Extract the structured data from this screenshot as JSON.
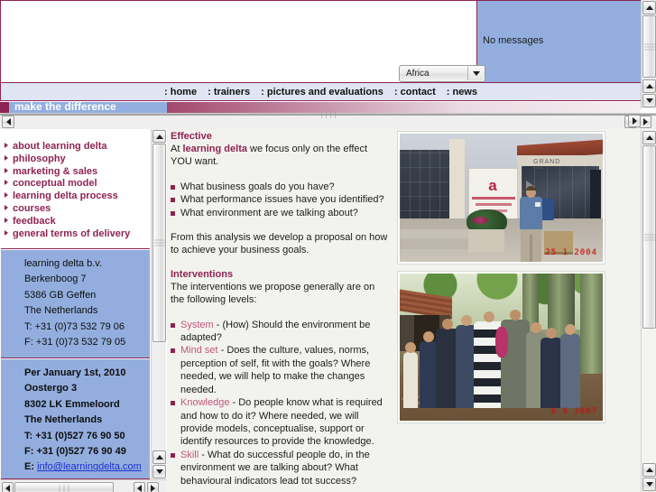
{
  "window": {
    "messages_panel": {
      "text": "No messages"
    },
    "country_select": {
      "value": "Africa",
      "arrow_icon": "chevron-down-icon"
    },
    "banner_tagline": "make the difference"
  },
  "navbar": {
    "items": [
      {
        "label": "home"
      },
      {
        "label": "trainers"
      },
      {
        "label": "pictures and evaluations"
      },
      {
        "label": "contact"
      },
      {
        "label": "news"
      }
    ]
  },
  "sidebar": {
    "nav_items": [
      {
        "label": "about learning delta"
      },
      {
        "label": "philosophy"
      },
      {
        "label": "marketing & sales"
      },
      {
        "label": "conceptual model"
      },
      {
        "label": "learning delta process"
      },
      {
        "label": "courses"
      },
      {
        "label": "feedback"
      },
      {
        "label": "general terms of delivery"
      }
    ],
    "address_current": {
      "lines": [
        "learning delta b.v.",
        "Berkenboog 7",
        "5386 GB Geffen",
        "The Netherlands",
        "T: +31 (0)73 532 79 06",
        "F: +31 (0)73 532 79 05"
      ]
    },
    "address_new": {
      "lines": [
        "Per January 1st, 2010",
        "Oostergo 3",
        "8302 LK Emmeloord",
        "The Netherlands",
        "T: +31 (0)527 76 90 50",
        "F: +31 (0)527 76 90 49"
      ],
      "email_label": "E:",
      "email": "info@learningdelta.com"
    }
  },
  "article": {
    "section1": {
      "heading": "Effective",
      "intro_before": "At ",
      "intro_brand": "learning delta",
      "intro_after": " we focus only on the effect YOU want.",
      "bullets": [
        "What business goals do you have?",
        "What performance issues have you identified?",
        "What environment are we talking about?"
      ],
      "closing": "From this analysis we develop a proposal on how to achieve your business goals."
    },
    "section2": {
      "heading": "Interventions",
      "intro": "The interventions we propose generally are on the following levels:",
      "levels": [
        {
          "term": "System",
          "text": " - (How) Should the environment be adapted?"
        },
        {
          "term": "Mind set",
          "text": " - Does the culture, values, norms, perception of self, fit with the goals? Where needed, we will help to make the changes needed."
        },
        {
          "term": "Knowledge",
          "text": " - Do people know what is required and how to do it? Where needed, we will provide models, conceptualise, support or identify resources to provide the knowledge."
        },
        {
          "term": "Skill",
          "text": " - What do successful people do, in the environment we are talking about? What behavioural indicators lead tot success?"
        }
      ]
    }
  },
  "photos": [
    {
      "name": "photo-plaza-building",
      "alt": "Man standing in front of a building plaza with GRAND signage",
      "datestamp": "25  1 2004"
    },
    {
      "name": "photo-forest-group",
      "alt": "Group of people gathered in a forest clearing",
      "datestamp": "6  6 2007"
    }
  ],
  "scrollbars": {
    "up_icon": "arrow-up-icon",
    "down_icon": "arrow-down-icon",
    "left_icon": "arrow-left-icon",
    "right_icon": "arrow-right-icon"
  },
  "colors": {
    "brand": "#8e2352",
    "panel_blue": "#93aede",
    "nav_bg": "#dfe5f2",
    "link": "#1c33cf",
    "term": "#c1577f"
  }
}
